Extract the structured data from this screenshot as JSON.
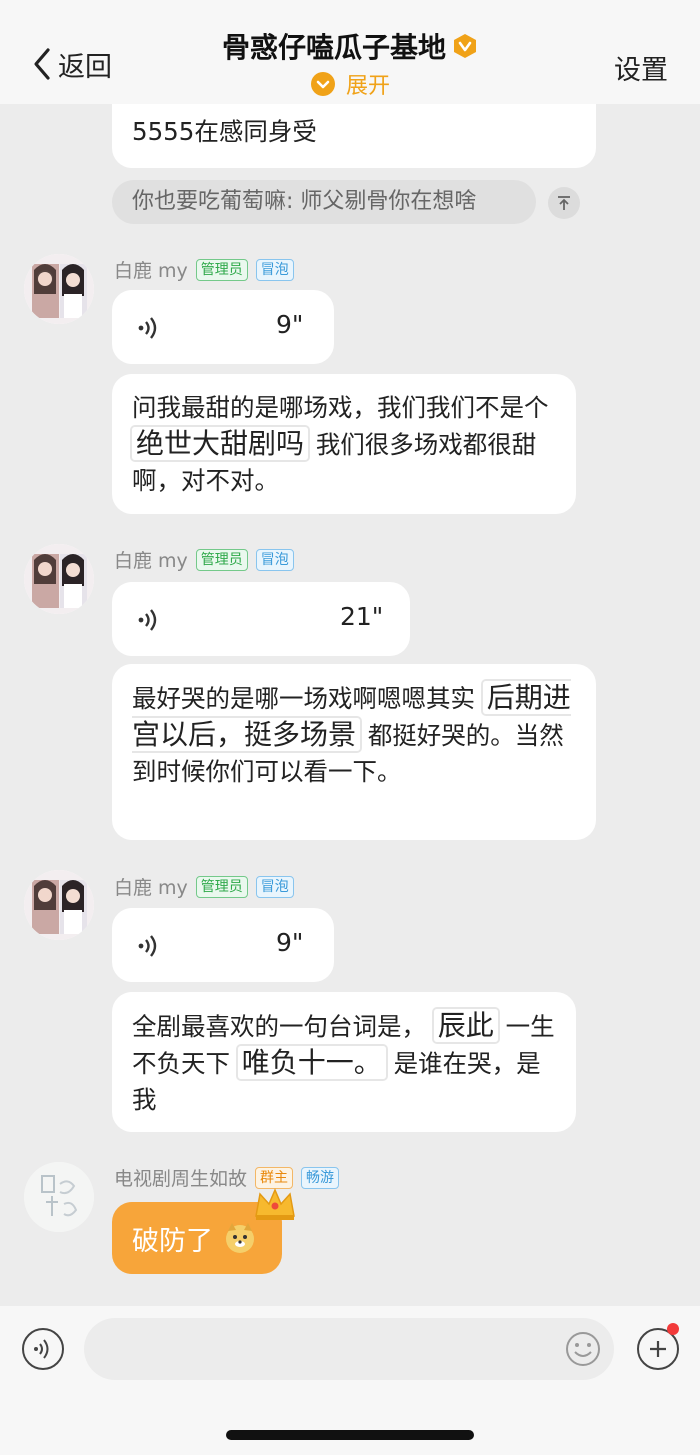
{
  "header": {
    "back_label": "返回",
    "title": "骨惑仔嗑瓜子基地",
    "expand_label": "展开",
    "settings_label": "设置"
  },
  "top_message": {
    "visible_text": "5555在感同身受",
    "quote": "你也要吃葡萄嘛: 师父剔骨你在想啥"
  },
  "messages": [
    {
      "sender": "白鹿 my",
      "tags": [
        "管理员",
        "冒泡"
      ],
      "voice_duration": "9\"",
      "text_before": "问我最甜的是哪场戏，我们我们不是个",
      "highlight": "绝世大甜剧吗",
      "text_after": "我们很多场戏都很甜啊，对不对。"
    },
    {
      "sender": "白鹿 my",
      "tags": [
        "管理员",
        "冒泡"
      ],
      "voice_duration": "21\"",
      "text_before": "最好哭的是哪一场戏啊嗯嗯其实",
      "highlight": "后期进宫以后，挺多场景",
      "text_after": "都挺好哭的。当然到时候你们可以看一下。"
    },
    {
      "sender": "白鹿 my",
      "tags": [
        "管理员",
        "冒泡"
      ],
      "voice_duration": "9\"",
      "text_before": "全剧最喜欢的一句台词是，",
      "highlight1": "辰此",
      "text_mid": "一生不负天下",
      "highlight2": "唯负十一。",
      "text_after": "是谁在哭，是我"
    },
    {
      "sender": "电视剧周生如故",
      "tags": [
        "群主",
        "畅游"
      ],
      "text": "破防了"
    }
  ],
  "composer": {
    "placeholder": ""
  },
  "colors": {
    "accent_orange": "#f7a53a",
    "badge_gold": "#f0a218",
    "admin_green": "#2fa94a",
    "bubble_blue": "#3a9ad9"
  }
}
